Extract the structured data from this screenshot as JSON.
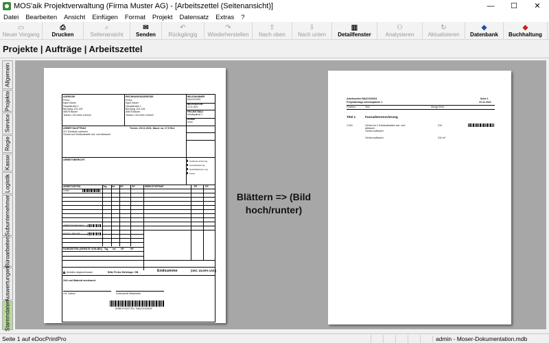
{
  "window": {
    "title": "MOS'aik Projektverwaltung (Firma Muster AG) - [Arbeitszettel (Seitenansicht)]",
    "minimize": "—",
    "maximize": "☐",
    "close": "✕"
  },
  "menu": [
    "Datei",
    "Bearbeiten",
    "Ansicht",
    "Einfügen",
    "Format",
    "Projekt",
    "Datensatz",
    "Extras",
    "?"
  ],
  "toolbar": [
    {
      "label": "Neuer Vorgang",
      "icon": "▭",
      "disabled": true
    },
    {
      "label": "Drucken",
      "icon": "⎙",
      "disabled": false,
      "bold": true
    },
    {
      "label": "Seitenansicht",
      "icon": "⌕",
      "disabled": true
    },
    {
      "label": "Senden",
      "icon": "✉",
      "disabled": false,
      "bold": true
    },
    {
      "label": "Rückgängig",
      "icon": "↶",
      "disabled": true
    },
    {
      "label": "Wiederherstellen",
      "icon": "↷",
      "disabled": true
    },
    {
      "label": "Nach oben",
      "icon": "⇧",
      "disabled": true
    },
    {
      "label": "Nach unten",
      "icon": "⇩",
      "disabled": true
    },
    {
      "label": "Detailfenster",
      "icon": "▥",
      "disabled": false,
      "bold": true
    },
    {
      "label": "Analysieren",
      "icon": "⚇",
      "disabled": true
    },
    {
      "label": "Aktualisieren",
      "icon": "↻",
      "disabled": true
    },
    {
      "label": "Datenbank",
      "icon": "◆",
      "disabled": false,
      "bold": true,
      "color": "#1e4fb0"
    },
    {
      "label": "Buchhaltung",
      "icon": "◆",
      "disabled": false,
      "bold": true,
      "color": "#c62020"
    }
  ],
  "breadcrumb": "Projekte | Aufträge | Arbeitszettel",
  "sidebar_tabs": [
    "Allgemein",
    "Projekte",
    "Service",
    "Regie",
    "Kasse",
    "Logistik",
    "Subunternehmer",
    "Büroarbeiten",
    "Auswertungen",
    "Stammdaten"
  ],
  "center_text": "Blättern => (Bild hoch/runter)",
  "page1": {
    "adresse_h": "ADRESSE",
    "adresse": [
      "Firma",
      "Egon Bauer",
      "Hauptstraße 1",
      "Büroweg 123-125",
      "45678 Bauen",
      "Telefon +49 4404 144443"
    ],
    "rechnung_h": "RECHNUNGSADRESSE",
    "rechnung": [
      "Firma",
      "Egon Bauer",
      "Hauptstraße 1",
      "Büroweg 123-125",
      "45678 Bauen",
      "Telefon +49 4404 144443"
    ],
    "side": [
      [
        "BELEGNUMMER",
        "MAZ2100003"
      ],
      [
        "BELEGDATUM",
        "22.11.2021"
      ],
      [
        "PROJEKT/BAU",
        "Arbeitspakete 1"
      ],
      [
        "KUNDE",
        "xxxxx"
      ]
    ],
    "auftrag_h": "ARBEITSAUFTRAG",
    "auftrag": [
      "Z/V Gebäude sanieren",
      "Gerüst auf Gebäudeseite auf- und abbauen"
    ],
    "termin": "Termin: 29.11.2021, Dauer ca. 17,5 Std.",
    "bericht_h": "ARBEITSBERICHT",
    "checks": [
      "Gebäude sicherung",
      "Gerüstbedarf stg",
      "Nachfüllarbeiten stg",
      "Fixiert"
    ],
    "cols1": [
      "ARBEITSZEITEN",
      "Tag",
      "Std",
      "GP",
      "GP"
    ],
    "cols2": [
      "WERKSTOFF/MAT",
      "EP",
      "GP"
    ],
    "row1": "Leiter",
    "anfahrt": "ARBEITSANFANG",
    "ende": "ENDE / PAUSE",
    "fahrz": "FAHRZEITEN (GERÄTE VON-BIS)",
    "fahrz_cols": [
      "Tag",
      "km",
      "GP",
      "GP"
    ],
    "fertig": "Arbeiten abgeschlossen",
    "mehrtage": "Bitte Preise Mehrtage: GB",
    "endsumme": "Endsumme",
    "inkl": "(inkl. 15,00% USt.)",
    "material": "Zeit und Material anerkannt:",
    "ort": "Ort, Datum",
    "unterschrift": "Unterschrift Mitarbeiter",
    "footer": "ARBEITSZETTEL *MAZ2100003*"
  },
  "page2": {
    "title": "Arbeitszettel MAZ2100003",
    "project": "Projektbeilage Arbeitspakete 1",
    "seite": "Seite 1",
    "date": "22.11.2021",
    "cols": [
      "Position",
      "Text",
      "Menge Einh."
    ],
    "titel": "Titel 1",
    "titel_text": "Fassadenrenovierung",
    "items": [
      {
        "pos": "1.001",
        "text": [
          "Gerüst an 4 Gebäudeseiten auf- und",
          "abbauen",
          "Gerüst aufbauen"
        ],
        "qty": "210"
      },
      {
        "pos": "",
        "text": [
          "Gerüst aufbauen"
        ],
        "qty": "210 m²"
      }
    ]
  },
  "status": {
    "left": "Seite 1 auf eDocPrintPro",
    "right": "admin - Moser-Dokumentation.mdb"
  }
}
